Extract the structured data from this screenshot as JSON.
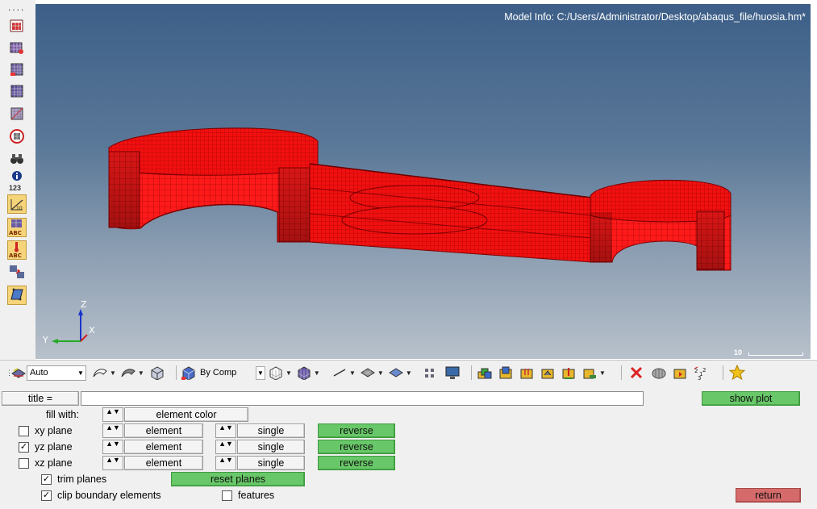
{
  "viewport": {
    "model_info": "Model Info: C:/Users/Administrator/Desktop/abaqus_file/huosia.hm*",
    "background_top": "#3d5f88",
    "background_bottom": "#b8c1cb",
    "mesh_color": "#ff0000",
    "mesh_line_color": "#8a0000",
    "axis": {
      "z": "Z",
      "y": "Y",
      "x": "X"
    },
    "scale_value": "10"
  },
  "left_toolbar": {
    "dots": "....",
    "info_label": "123",
    "abc_label": "ABC"
  },
  "bottom_toolbar": {
    "display_mode": "Auto",
    "color_mode": "By Comp"
  },
  "panel": {
    "title_label": "title =",
    "title_value": "",
    "show_plot": "show plot",
    "fill_with_label": "fill with:",
    "fill_with_value": "element color",
    "planes": [
      {
        "label": "xy plane",
        "checked": false,
        "type": "element",
        "mode": "single",
        "action": "reverse"
      },
      {
        "label": "yz plane",
        "checked": true,
        "type": "element",
        "mode": "single",
        "action": "reverse"
      },
      {
        "label": "xz plane",
        "checked": false,
        "type": "element",
        "mode": "single",
        "action": "reverse"
      }
    ],
    "trim_planes": {
      "label": "trim planes",
      "checked": true
    },
    "reset_planes": "reset planes",
    "clip_boundary": {
      "label": "clip boundary elements",
      "checked": true
    },
    "features": {
      "label": "features",
      "checked": false
    },
    "return": "return",
    "check_mark": "✓",
    "spinner": "▲▼"
  },
  "colors": {
    "green_button": "#68c768",
    "red_button": "#d46a6a",
    "highlight": "#f6d479"
  }
}
